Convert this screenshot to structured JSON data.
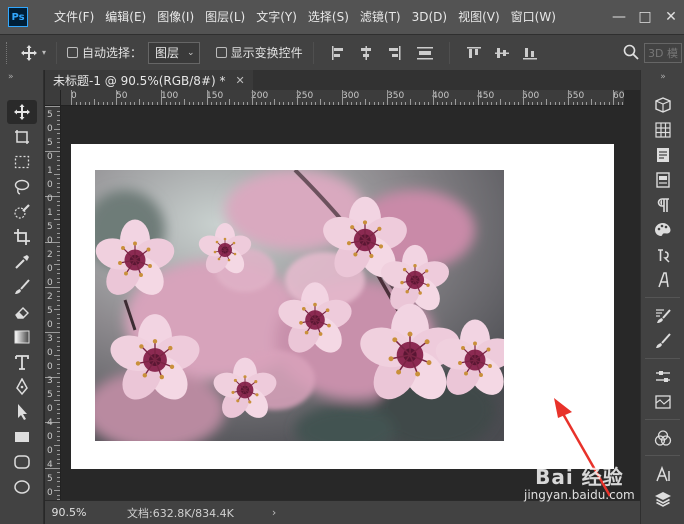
{
  "app": {
    "logo": "Ps"
  },
  "menu": [
    "文件(F)",
    "编辑(E)",
    "图像(I)",
    "图层(L)",
    "文字(Y)",
    "选择(S)",
    "滤镜(T)",
    "3D(D)",
    "视图(V)",
    "窗口(W)"
  ],
  "window_controls": {
    "minimize": "—",
    "maximize": "□",
    "close": "✕"
  },
  "options": {
    "auto_select_label": "自动选择：",
    "layer_select_value": "图层",
    "show_transform_label": "显示变换控件",
    "mode_3d": "3D 模"
  },
  "toolbar_header": "»",
  "document": {
    "tab_title": "未标题-1 @ 90.5%(RGB/8#) *",
    "close": "✕"
  },
  "rulers": {
    "h_labels": [
      "0",
      "50",
      "100",
      "150",
      "200",
      "250",
      "300",
      "350",
      "400",
      "450",
      "500",
      "550",
      "60"
    ],
    "v_labels": [
      "5",
      "0",
      "5",
      "0",
      "1",
      "0",
      "0",
      "1",
      "5",
      "0",
      "2",
      "0",
      "0",
      "2",
      "5",
      "0",
      "3",
      "0",
      "0",
      "3",
      "5",
      "0",
      "4",
      "0",
      "0",
      "4",
      "5",
      "0"
    ]
  },
  "status": {
    "zoom": "90.5%",
    "doc_size": "文档:632.8K/834.4K",
    "arrow": "›"
  },
  "watermark": {
    "logo": "Bai 经验",
    "url": "jingyan.baidu.com"
  },
  "colors": {
    "menubar": "#535353",
    "panel": "#424242",
    "workspace": "#282828",
    "accent_arrow": "#e8322a"
  }
}
